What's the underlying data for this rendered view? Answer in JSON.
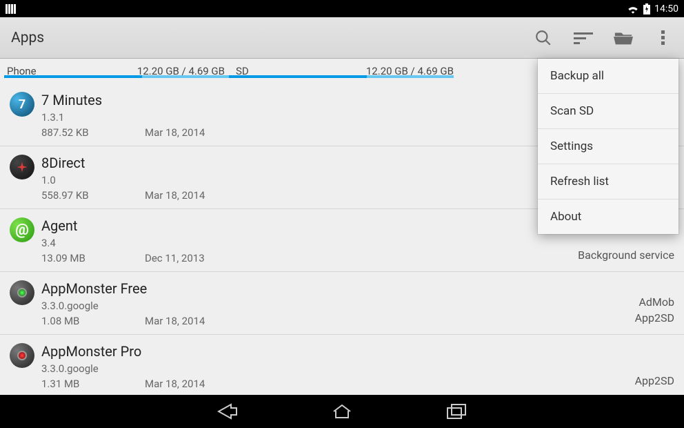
{
  "status": {
    "time": "14:50"
  },
  "actionbar": {
    "title": "Apps"
  },
  "storage": {
    "phone_label": "Phone",
    "phone_value": "12.20 GB / 4.69 GB",
    "sd_label": "SD",
    "sd_value": "12.20 GB / 4.69 GB"
  },
  "apps": {
    "0": {
      "name": "7 Minutes",
      "version": "1.3.1",
      "size": "887.52 KB",
      "date": "Mar 18, 2014",
      "tag1": "",
      "tag2": ""
    },
    "1": {
      "name": "8Direct",
      "version": "1.0",
      "size": "558.97 KB",
      "date": "Mar 18, 2014",
      "tag1": "",
      "tag2": ""
    },
    "2": {
      "name": "Agent",
      "version": "3.4",
      "size": "13.09 MB",
      "date": "Dec 11, 2013",
      "tag1": "",
      "tag2": "Background service"
    },
    "3": {
      "name": "AppMonster Free",
      "version": "3.3.0.google",
      "size": "1.08 MB",
      "date": "Mar 18, 2014",
      "tag1": "AdMob",
      "tag2": "App2SD"
    },
    "4": {
      "name": "AppMonster Pro",
      "version": "3.3.0.google",
      "size": "1.31 MB",
      "date": "Mar 18, 2014",
      "tag1": "",
      "tag2": "App2SD"
    }
  },
  "menu": {
    "0": "Backup all",
    "1": "Scan SD",
    "2": "Settings",
    "3": "Refresh list",
    "4": "About"
  }
}
